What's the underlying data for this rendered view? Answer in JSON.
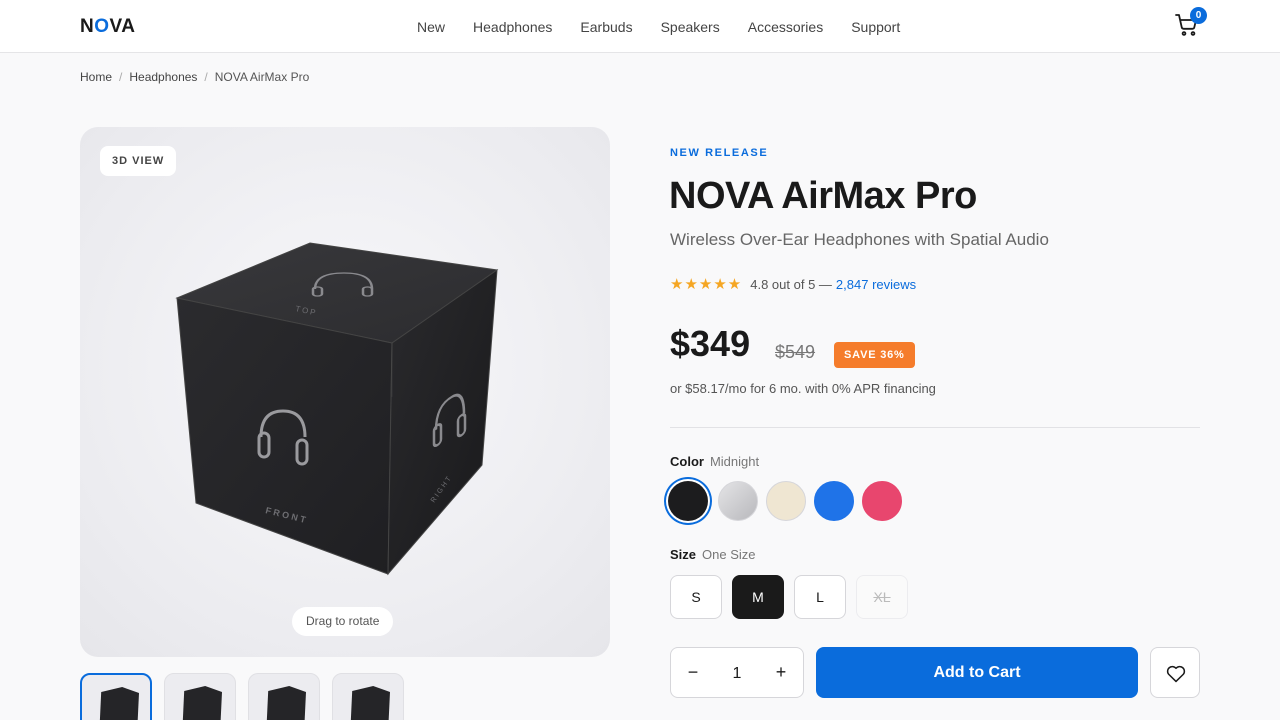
{
  "brand": {
    "logo_prefix": "N",
    "logo_o": "O",
    "logo_suffix": "VA"
  },
  "nav": {
    "items": [
      "New",
      "Headphones",
      "Earbuds",
      "Speakers",
      "Accessories",
      "Support"
    ]
  },
  "cart": {
    "count": "0",
    "icon": "cart-icon"
  },
  "breadcrumb": {
    "items": [
      "Home",
      "Headphones"
    ],
    "current": "NOVA AirMax Pro"
  },
  "viewer": {
    "badge": "3D VIEW",
    "hint": "Drag to rotate",
    "face_labels": {
      "top": "TOP",
      "front": "FRONT",
      "right": "RIGHT"
    },
    "thumbnail_count": 4,
    "active_thumbnail": 1
  },
  "product": {
    "eyebrow": "NEW RELEASE",
    "title": "NOVA AirMax Pro",
    "subtitle": "Wireless Over-Ear Headphones with Spatial Audio",
    "stars": "★★★★★",
    "rating_text": "4.8 out of 5 —",
    "reviews_link": "2,847 reviews",
    "price": "$349",
    "old_price": "$549",
    "save_badge": "SAVE 36%",
    "financing": "or $58.17/mo for 6 mo. with 0% APR financing"
  },
  "color": {
    "label": "Color",
    "selected": "Midnight",
    "swatches": [
      {
        "name": "Midnight",
        "hex": "#1c1c1e",
        "selected": true
      },
      {
        "name": "Silver",
        "hex": "#c8c8cc"
      },
      {
        "name": "Ivory",
        "hex": "#efe6d2"
      },
      {
        "name": "Blue",
        "hex": "#1f73e8"
      },
      {
        "name": "Pink",
        "hex": "#e8466e"
      }
    ]
  },
  "size": {
    "label": "Size",
    "selected": "One Size",
    "options": [
      {
        "label": "S",
        "state": "normal"
      },
      {
        "label": "M",
        "state": "selected"
      },
      {
        "label": "L",
        "state": "normal"
      },
      {
        "label": "XL",
        "state": "disabled"
      }
    ]
  },
  "purchase": {
    "qty_minus": "−",
    "qty_value": "1",
    "qty_plus": "+",
    "add_to_cart": "Add to Cart",
    "wishlist_icon": "heart-icon"
  },
  "colors": {
    "accent": "#0a6cdc",
    "save": "#f57c2b",
    "star": "#f5a623"
  }
}
